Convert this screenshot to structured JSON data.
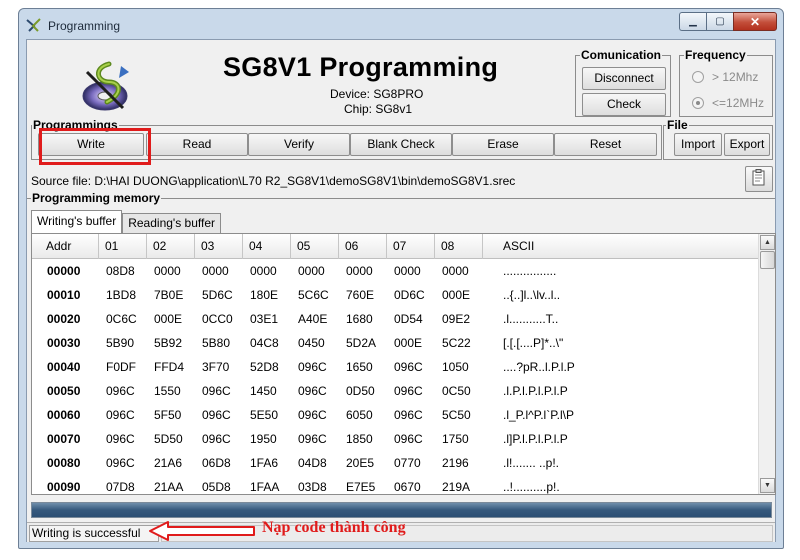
{
  "window": {
    "title": "Programming",
    "min_icon": "minimize-icon",
    "max_icon": "maximize-icon",
    "close_icon": "close-icon",
    "min_glyph": "▁",
    "max_glyph": "▢",
    "close_glyph": "✕"
  },
  "header": {
    "app_title": "SG8V1 Programming",
    "device_line": "Device: SG8PRO",
    "chip_line": "Chip: SG8v1",
    "logo_icon": "program-logo-icon"
  },
  "communication": {
    "legend": "Comunication",
    "disconnect_label": "Disconnect",
    "check_label": "Check"
  },
  "frequency": {
    "legend": "Frequency",
    "options": [
      {
        "label": "> 12Mhz",
        "selected": false
      },
      {
        "label": "<=12MHz",
        "selected": true
      }
    ]
  },
  "programming": {
    "legend": "Programmings",
    "buttons": [
      "Write",
      "Read",
      "Verify",
      "Blank Check",
      "Erase",
      "Reset"
    ]
  },
  "file": {
    "legend": "File",
    "import_label": "Import",
    "export_label": "Export"
  },
  "source": {
    "text": "Source file:  D:\\HAI DUONG\\application\\L70 R2_SG8V1\\demoSG8V1\\bin\\demoSG8V1.srec",
    "browse_icon": "browse-file-icon"
  },
  "memory": {
    "legend": "Programming memory",
    "tabs": [
      {
        "label": "Writing's buffer",
        "active": true
      },
      {
        "label": "Reading's buffer",
        "active": false
      }
    ],
    "columns": [
      "Addr",
      "01",
      "02",
      "03",
      "04",
      "05",
      "06",
      "07",
      "08",
      "ASCII"
    ],
    "rows": [
      [
        "00000",
        "08D8",
        "0000",
        "0000",
        "0000",
        "0000",
        "0000",
        "0000",
        "0000",
        "................"
      ],
      [
        "00010",
        "1BD8",
        "7B0E",
        "5D6C",
        "180E",
        "5C6C",
        "760E",
        "0D6C",
        "000E",
        "..{..]l..\\lv..l.."
      ],
      [
        "00020",
        "0C6C",
        "000E",
        "0CC0",
        "03E1",
        "A40E",
        "1680",
        "0D54",
        "09E2",
        ".l...........T.."
      ],
      [
        "00030",
        "5B90",
        "5B92",
        "5B80",
        "04C8",
        "0450",
        "5D2A",
        "000E",
        "5C22",
        "[.[.[....P]*..\\\""
      ],
      [
        "00040",
        "F0DF",
        "FFD4",
        "3F70",
        "52D8",
        "096C",
        "1650",
        "096C",
        "1050",
        "....?pR..l.P.l.P"
      ],
      [
        "00050",
        "096C",
        "1550",
        "096C",
        "1450",
        "096C",
        "0D50",
        "096C",
        "0C50",
        ".l.P.l.P.l.P.l.P"
      ],
      [
        "00060",
        "096C",
        "5F50",
        "096C",
        "5E50",
        "096C",
        "6050",
        "096C",
        "5C50",
        ".l_P.l^P.l`P.l\\P"
      ],
      [
        "00070",
        "096C",
        "5D50",
        "096C",
        "1950",
        "096C",
        "1850",
        "096C",
        "1750",
        ".l]P.l.P.l.P.l.P"
      ],
      [
        "00080",
        "096C",
        "21A6",
        "06D8",
        "1FA6",
        "04D8",
        "20E5",
        "0770",
        "2196",
        ".l!....... ..p!."
      ],
      [
        "00090",
        "07D8",
        "21AA",
        "05D8",
        "1FAA",
        "03D8",
        "E7E5",
        "0670",
        "219A",
        "..!..........p!."
      ]
    ]
  },
  "progress": {
    "fraction": 1.0
  },
  "status": {
    "text": "Writing is successful"
  },
  "annotation": {
    "text": "Nạp code thành công",
    "arrow_icon": "arrow-left-icon"
  },
  "colors": {
    "highlight": "#e01b1b",
    "progress": "#36597d"
  }
}
